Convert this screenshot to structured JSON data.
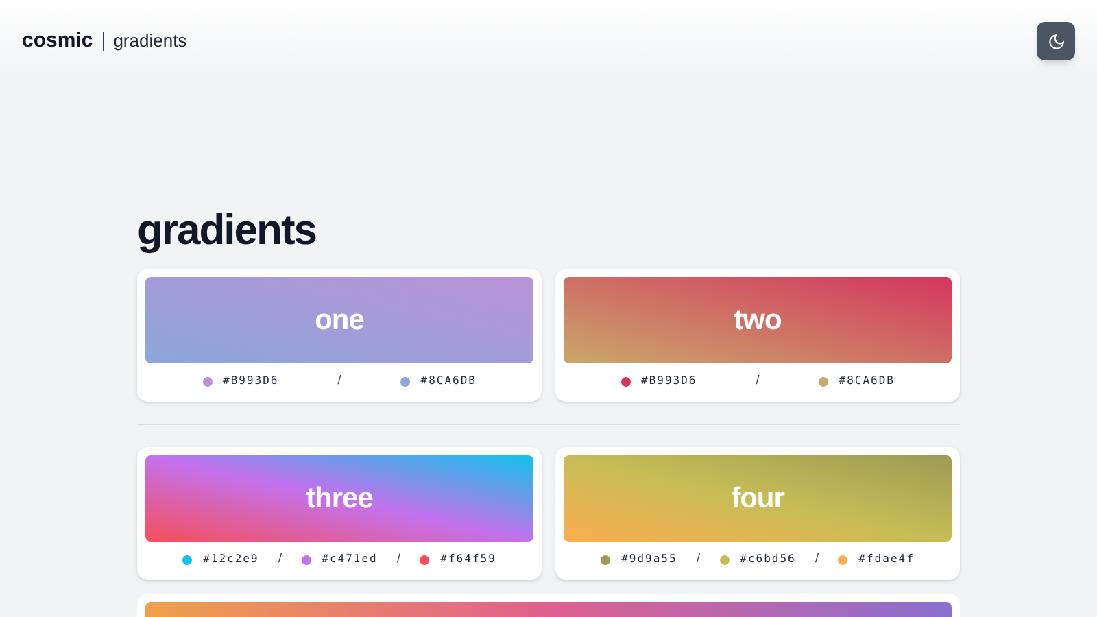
{
  "header": {
    "brand": "cosmic",
    "section": "gradients",
    "theme_button": {
      "kind": "moon"
    }
  },
  "page_title": "gradients",
  "groups": [
    {
      "cards": [
        {
          "kind": "full",
          "name": "one",
          "swatches": [
            {
              "label": "#B993D6",
              "color": "#b993d6"
            },
            {
              "label": "#8CA6DB",
              "color": "#8ca6db"
            }
          ]
        },
        {
          "kind": "full",
          "name": "two",
          "swatches": [
            {
              "label": "#B993D6",
              "color": "#d4365f"
            },
            {
              "label": "#8CA6DB",
              "color": "#c9a86a"
            }
          ]
        }
      ]
    },
    {
      "cards": [
        {
          "kind": "full",
          "name": "three",
          "swatches": [
            {
              "label": "#12c2e9",
              "color": "#12c2e9"
            },
            {
              "label": "#c471ed",
              "color": "#c471ed"
            },
            {
              "label": "#f64f59",
              "color": "#f64f59"
            }
          ]
        },
        {
          "kind": "full",
          "name": "four",
          "swatches": [
            {
              "label": "#9d9a55",
              "color": "#9d9a55"
            },
            {
              "label": "#c6bd56",
              "color": "#c6bd56"
            },
            {
              "label": "#fdae4f",
              "color": "#fdae4f"
            }
          ]
        },
        {
          "kind": "partial",
          "swatches": [
            {
              "color": "#8a6fd0"
            },
            {
              "color": "#e0608f"
            },
            {
              "color": "#f0a04b"
            }
          ]
        }
      ]
    }
  ],
  "separator": "/"
}
